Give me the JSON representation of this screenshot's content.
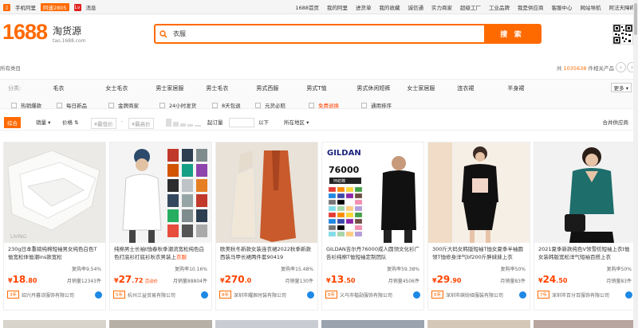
{
  "topbar": {
    "mobile_label": "手机阿里",
    "hot_label": "阿速2805",
    "msg_label": "消息",
    "links": [
      "1688首页",
      "我的阿里",
      "进货单",
      "我的收藏",
      "诚信通",
      "实力商家",
      "超级工厂",
      "工业品牌",
      "我是供应商",
      "客服中心",
      "网站导航",
      "阿法天障碍"
    ],
    "cart_count": "0"
  },
  "header": {
    "logo_text": "1688",
    "logo_sub": "淘货源",
    "logo_url": "tao.1688.com",
    "search_value": "衣服",
    "search_button": "搜 索"
  },
  "meta": {
    "breadcrumb": "所有类目",
    "count_prefix": "共",
    "count_value": "1035638",
    "count_suffix": "件相关产品"
  },
  "filters": {
    "category_label": "分类:",
    "categories": [
      "毛衣",
      "女士毛衣",
      "男士家居服",
      "男士毛衣",
      "男式西服",
      "男式T恤",
      "男式休闲短裤",
      "女士家居服",
      "连衣裙",
      "半身裙"
    ],
    "more_label": "更多",
    "options": [
      "热销爆款",
      "每日新品",
      "金牌商家",
      "24小时发货",
      "8天包退",
      "元货必赔",
      "免费退换",
      "通用排序"
    ]
  },
  "sortbar": {
    "comprehensive": "综合",
    "sales": "销量",
    "price": "价格",
    "min_price_placeholder": "¥最低价",
    "max_price_placeholder": "¥最高价",
    "unit_label": "起订量",
    "unit_suffix": "以下",
    "location": "所在地区",
    "merge": "合并供应商"
  },
  "products": [
    {
      "title": "230g日本重磅纯棉短袖男女纯色白色T恤宽松体恤潮ins款宽松",
      "title_highlight": "",
      "rate": "复购率9.54%",
      "price_int": "18",
      "price_dec": ".80",
      "price_tag": "",
      "volume": "月销量12343件",
      "years": "3年",
      "shop": "绍兴丹暮诗服饰有限公司"
    },
    {
      "title": "纯棉男士长袖t恤春秋季潮流宽松纯色白色打底衫打底衫秋衣男装上",
      "title_highlight": "衣服",
      "rate": "复购率10.16%",
      "price_int": "27",
      "price_dec": ".72",
      "price_tag": "活动价",
      "volume": "月销量88804件",
      "years": "5年",
      "shop": "杭州三益贸易有限公司"
    },
    {
      "title": "欧美秋冬新款女装连衣裙2022秋季新款西装马甲长裙两件套90419",
      "title_highlight": "",
      "rate": "复购率15.48%",
      "price_int": "270",
      "price_dec": ".0",
      "price_tag": "",
      "volume": "月销量130件",
      "years": "8年",
      "shop": "深圳市耀辰时装有限公司"
    },
    {
      "title": "GILDAN吉尔丹76000成人圆领文化衫广告衫纯棉T恤短袖定制团队",
      "title_highlight": "",
      "rate": "复购率59.38%",
      "price_int": "13",
      "price_dec": ".50",
      "price_tag": "",
      "volume": "月销量4506件",
      "years": "6年",
      "shop": "义乌市楷勋服饰有限公司"
    },
    {
      "title": "300斤大码女韩版短袖T恤女夏季半袖圆领T恤修身洋气bf200斤胖妹妹上衣",
      "title_highlight": "",
      "rate": "复购率50%",
      "price_int": "29",
      "price_dec": ".90",
      "price_tag": "",
      "volume": "月销量83件",
      "years": "6年",
      "shop": "深圳市缤纷娅服装有限公司"
    },
    {
      "title": "2021夏季新款纯色V领雪纺短袖上衣t恤女装韩版宽松洋气短袖百搭上衣",
      "title_highlight": "",
      "rate": "复购率50%",
      "price_int": "24",
      "price_dec": ".50",
      "price_tag": "",
      "volume": "月销量83件",
      "years": "7年",
      "shop": "深圳市百分百服饰有限公司"
    }
  ],
  "colors": {
    "accent": "#ff6a00",
    "price": "#ff4400"
  }
}
